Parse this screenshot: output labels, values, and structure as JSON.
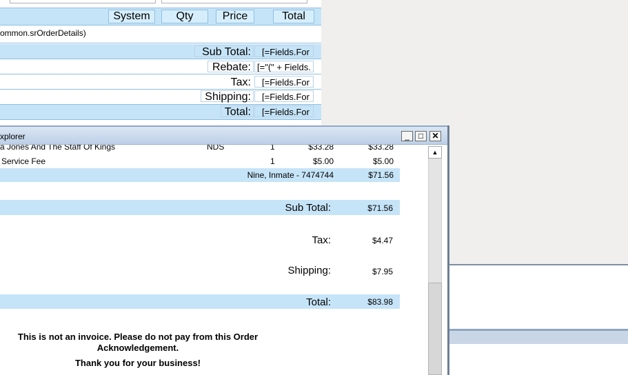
{
  "designer": {
    "headers": [
      "System",
      "Qty",
      "Price",
      "Total"
    ],
    "detail_text": "ommon.srOrderDetails)",
    "totals": [
      {
        "label": "Sub Total:",
        "field": "[=Fields.For"
      },
      {
        "label": "Rebate:",
        "field": "[=\"(\" + Fields."
      },
      {
        "label": "Tax:",
        "field": "[=Fields.For"
      },
      {
        "label": "Shipping:",
        "field": "[=Fields.For"
      },
      {
        "label": "Total:",
        "field": "[=Fields.For"
      }
    ]
  },
  "window": {
    "title": "xplorer",
    "minimize_symbol": "_",
    "maximize_symbol": "□",
    "close_symbol": "✕",
    "scroll_up_symbol": "▲"
  },
  "report": {
    "items": [
      {
        "name": "a Jones And The Staff Of Kings",
        "system": "NDS",
        "qty": "1",
        "price": "$33.28",
        "total": "$33.28"
      },
      {
        "name": "Service Fee",
        "system": "",
        "qty": "1",
        "price": "$5.00",
        "total": "$5.00"
      }
    ],
    "group_label": "Nine, Inmate - 7474744",
    "group_total": "$71.56",
    "subtotal_label": "Sub Total:",
    "subtotal_value": "$71.56",
    "tax_label": "Tax:",
    "tax_value": "$4.47",
    "shipping_label": "Shipping:",
    "shipping_value": "$7.95",
    "total_label": "Total:",
    "total_value": "$83.98",
    "notice_line1": "This is not an invoice. Please do not pay from this Order",
    "notice_line2": "Acknowledgement.",
    "thanks": "Thank you for your business!"
  },
  "colors": {
    "band_blue": "#c6e4f8",
    "window_frame": "#6d7e93",
    "right_panel": "#f0efee"
  }
}
